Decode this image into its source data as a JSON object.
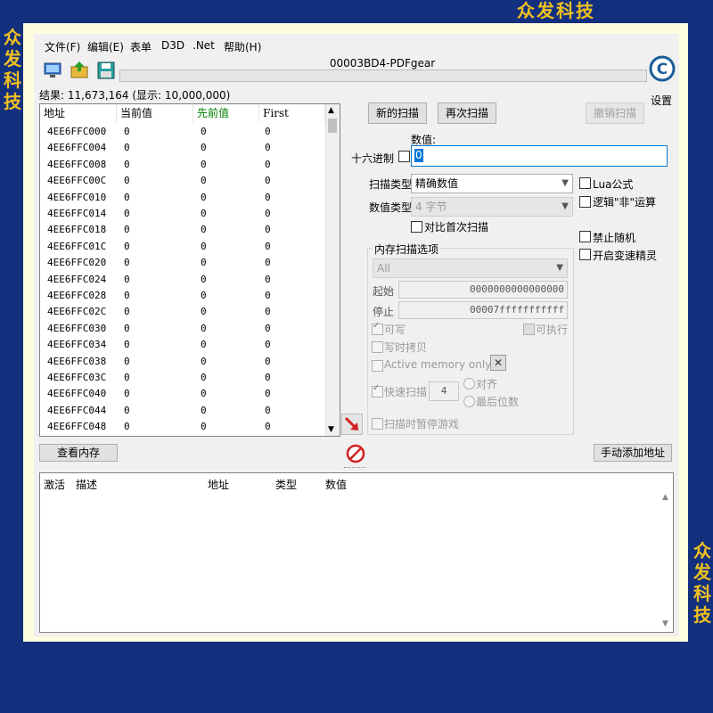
{
  "watermark": {
    "text": "众发科技",
    "chars": [
      "众",
      "发",
      "科",
      "技"
    ]
  },
  "menu": {
    "file": "文件(F)",
    "edit": "编辑(E)",
    "table": "表单",
    "d3d": "D3D",
    "net": ".Net",
    "help": "帮助(H)"
  },
  "window": {
    "title": "00003BD4-PDFgear"
  },
  "settings_label": "设置",
  "results_label": "结果: 11,673,164 (显示: 10,000,000)",
  "list": {
    "headers": [
      "地址",
      "当前值",
      "先前值",
      "First"
    ],
    "rows": [
      [
        "4EE6FFC000",
        "0",
        "0",
        "0"
      ],
      [
        "4EE6FFC004",
        "0",
        "0",
        "0"
      ],
      [
        "4EE6FFC008",
        "0",
        "0",
        "0"
      ],
      [
        "4EE6FFC00C",
        "0",
        "0",
        "0"
      ],
      [
        "4EE6FFC010",
        "0",
        "0",
        "0"
      ],
      [
        "4EE6FFC014",
        "0",
        "0",
        "0"
      ],
      [
        "4EE6FFC018",
        "0",
        "0",
        "0"
      ],
      [
        "4EE6FFC01C",
        "0",
        "0",
        "0"
      ],
      [
        "4EE6FFC020",
        "0",
        "0",
        "0"
      ],
      [
        "4EE6FFC024",
        "0",
        "0",
        "0"
      ],
      [
        "4EE6FFC028",
        "0",
        "0",
        "0"
      ],
      [
        "4EE6FFC02C",
        "0",
        "0",
        "0"
      ],
      [
        "4EE6FFC030",
        "0",
        "0",
        "0"
      ],
      [
        "4EE6FFC034",
        "0",
        "0",
        "0"
      ],
      [
        "4EE6FFC038",
        "0",
        "0",
        "0"
      ],
      [
        "4EE6FFC03C",
        "0",
        "0",
        "0"
      ],
      [
        "4EE6FFC040",
        "0",
        "0",
        "0"
      ],
      [
        "4EE6FFC044",
        "0",
        "0",
        "0"
      ],
      [
        "4EE6FFC048",
        "0",
        "0",
        "0"
      ]
    ]
  },
  "buttons": {
    "new_scan": "新的扫描",
    "next_scan": "再次扫描",
    "undo_scan": "撤销扫描",
    "view_memory": "查看内存",
    "add_address": "手动添加地址"
  },
  "value": {
    "label": "数值:",
    "hex_label": "十六进制",
    "current": "0"
  },
  "scan_type": {
    "label": "扫描类型",
    "value": "精确数值"
  },
  "value_type": {
    "label": "数值类型",
    "value": "4 字节"
  },
  "compare_first": "对比首次扫描",
  "options": {
    "lua": "Lua公式",
    "not": "逻辑\"非\"运算",
    "no_random": "禁止随机",
    "speedhack": "开启变速精灵"
  },
  "mem": {
    "title": "内存扫描选项",
    "region": "All",
    "start_label": "起始",
    "start": "0000000000000000",
    "stop_label": "停止",
    "stop": "00007fffffffffff",
    "writable": "可写",
    "executable": "可执行",
    "copy_on_write": "写时拷贝",
    "active_memory": "Active memory only",
    "fast_scan": "快速扫描",
    "fast_value": "4",
    "align": "对齐",
    "last_digits": "最后位数",
    "pause_game": "扫描时暂停游戏"
  },
  "lower": {
    "headers": [
      "激活",
      "描述",
      "地址",
      "类型",
      "数值"
    ]
  },
  "colors": {
    "previous_header": "#008000",
    "background": "#13307e",
    "watermark": "#f0c020"
  }
}
